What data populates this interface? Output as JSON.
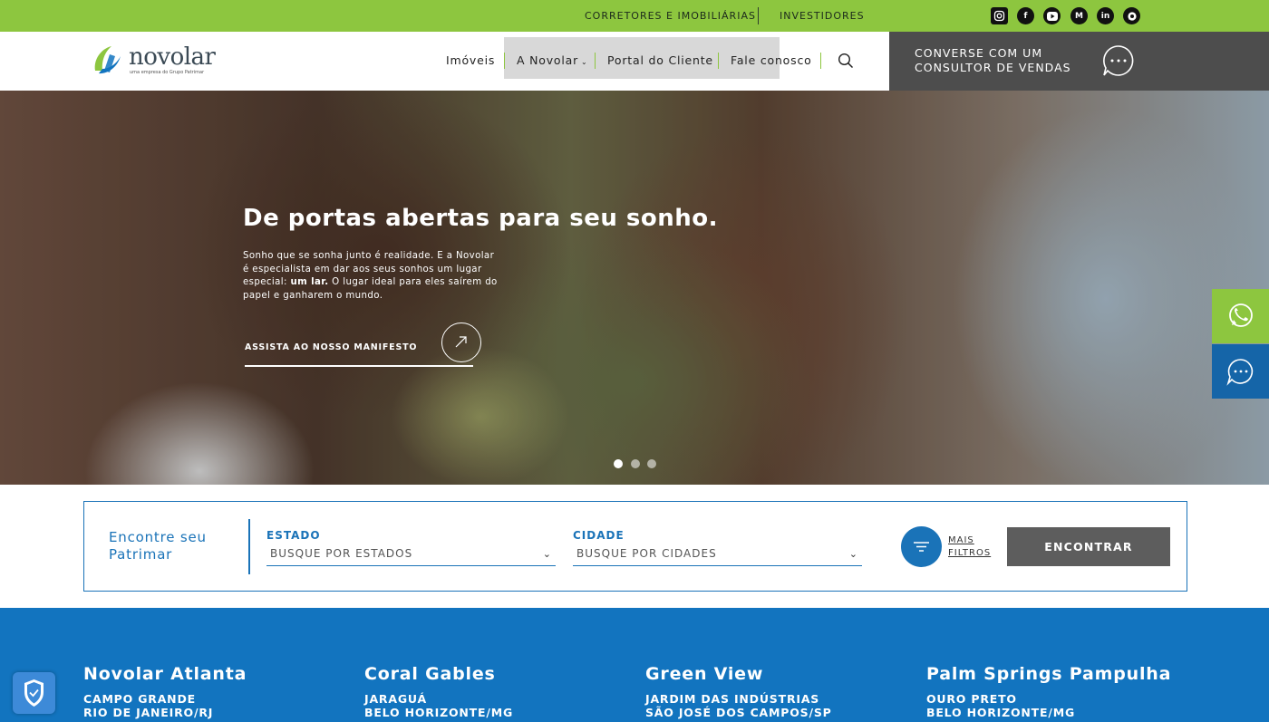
{
  "topbar": {
    "links": [
      "CORRETORES E IMOBILIÁRIAS",
      "INVESTIDORES"
    ],
    "social": [
      {
        "icon": "instagram-icon",
        "glyph": "◘"
      },
      {
        "icon": "facebook-icon",
        "glyph": "f"
      },
      {
        "icon": "youtube-icon",
        "glyph": "▶"
      },
      {
        "icon": "medium-icon",
        "glyph": "M"
      },
      {
        "icon": "linkedin-icon",
        "glyph": "in"
      },
      {
        "icon": "whatsapp-icon",
        "glyph": "✆"
      }
    ]
  },
  "header": {
    "logo_text": "novolar",
    "logo_sub": "uma empresa do Grupo Patrimar",
    "nav": [
      "Imóveis",
      "A Novolar",
      "Portal do Cliente",
      "Fale conosco"
    ],
    "consult_label": "CONVERSE COM UM CONSULTOR DE VENDAS"
  },
  "hero": {
    "title": "De portas abertas para seu sonho.",
    "text_part1": "Sonho que se sonha junto é realidade. E a Novolar é especialista em dar aos seus sonhos um lugar especial: ",
    "text_bold": "um lar.",
    "text_part2": " O lugar ideal para eles saírem do papel e ganharem o mundo.",
    "cta": "ASSISTA AO NOSSO MANIFESTO",
    "slides": 3,
    "active_slide": 0
  },
  "search": {
    "title": "Encontre seu Patrimar",
    "state_label": "ESTADO",
    "state_value": "BUSQUE POR ESTADOS",
    "city_label": "CIDADE",
    "city_value": "BUSQUE POR CIDADES",
    "more_filters": "MAIS FILTROS",
    "submit": "ENCONTRAR"
  },
  "listings": [
    {
      "name": "Novolar Atlanta",
      "neighborhood": "CAMPO GRANDE",
      "city": "RIO DE JANEIRO/RJ"
    },
    {
      "name": "Coral Gables",
      "neighborhood": "JARAGUÁ",
      "city": "BELO HORIZONTE/MG"
    },
    {
      "name": "Green View",
      "neighborhood": "JARDIM DAS INDÚSTRIAS",
      "city": "SÃO JOSÉ DOS CAMPOS/SP"
    },
    {
      "name": "Palm Springs Pampulha",
      "neighborhood": "OURO PRETO",
      "city": "BELO HORIZONTE/MG"
    }
  ],
  "colors": {
    "brand_green": "#8dc63f",
    "brand_blue": "#1274bf",
    "dark_gray": "#4d4d4d"
  }
}
